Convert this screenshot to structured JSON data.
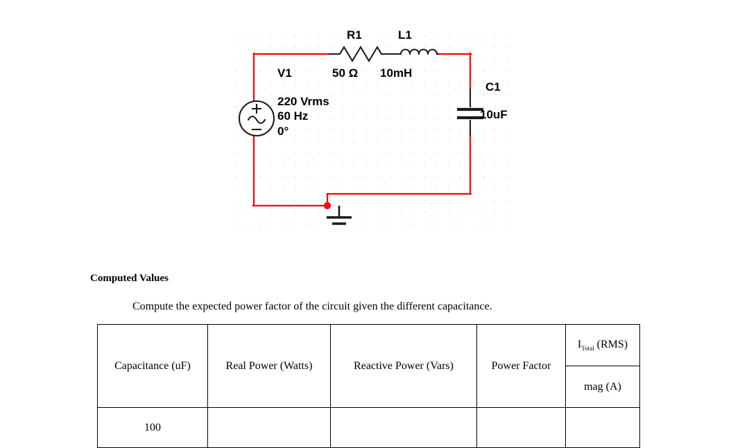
{
  "circuit": {
    "title_icons": {
      "source": "ac-voltage-source-icon",
      "resistor": "resistor-icon",
      "inductor": "inductor-icon",
      "capacitor": "capacitor-icon",
      "ground": "ground-icon",
      "junction": "junction-dot-icon"
    },
    "components": {
      "resistor_ref": "R1",
      "resistor_value": "50 Ω",
      "inductor_ref": "L1",
      "inductor_value": "10mH",
      "capacitor_ref": "C1",
      "capacitor_value": "10uF",
      "source_ref": "V1",
      "source_voltage": "220 Vrms",
      "source_frequency": "60 Hz",
      "source_phase": "0°",
      "source_plus": "+",
      "source_minus": "−"
    },
    "colors": {
      "wire": "#ff0000",
      "component": "#1a1a1a",
      "grid_dot": "#c8c8c8",
      "junction": "#ee1111"
    }
  },
  "computed": {
    "heading": "Computed Values",
    "instruction": "Compute the expected power factor of the circuit given the different capacitance."
  },
  "table": {
    "headers": {
      "capacitance": "Capacitance (uF)",
      "real_power": "Real Power (Watts)",
      "reactive_power": "Reactive Power (Vars)",
      "power_factor": "Power Factor",
      "current_symbol": "I",
      "current_subscript": "Total",
      "current_rms": " (RMS)",
      "current_mag": "mag (A)"
    },
    "rows": [
      {
        "capacitance": "100",
        "real_power": "",
        "reactive_power": "",
        "power_factor": "",
        "current_mag": ""
      }
    ]
  }
}
